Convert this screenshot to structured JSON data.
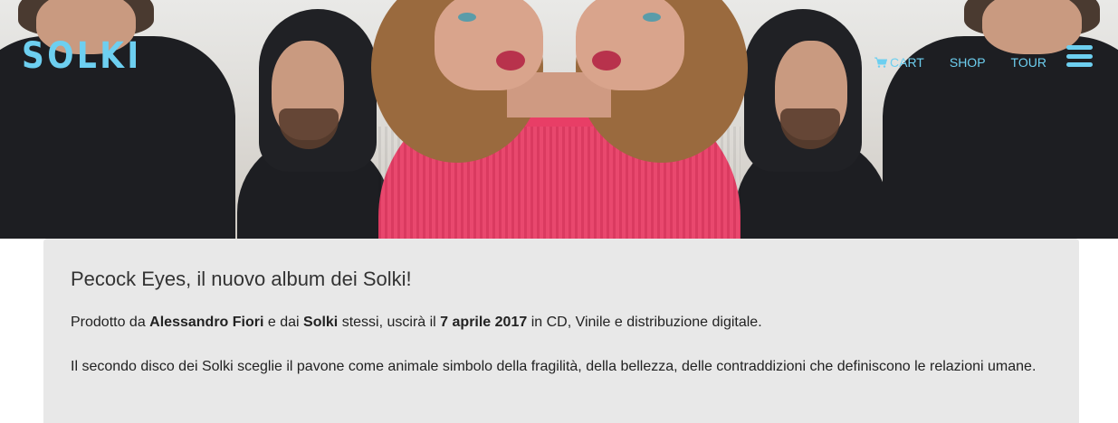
{
  "brand": {
    "logo_text": "SOLKI",
    "accent_color": "#6dcff0"
  },
  "nav": {
    "cart_icon": "shopping-cart-icon",
    "cart_label": "CART",
    "shop_label": "SHOP",
    "tour_label": "TOUR",
    "menu_icon": "hamburger-menu-icon"
  },
  "article": {
    "title": "Pecock Eyes, il nuovo album dei Solki!",
    "p1": {
      "t1": "Prodotto da ",
      "b1": "Alessandro Fiori",
      "t2": " e dai ",
      "b2": "Solki",
      "t3": " stessi, uscirà il ",
      "b3": "7 aprile 2017",
      "t4": " in CD, Vinile e distribuzione digitale."
    },
    "p2": "Il secondo disco dei Solki sceglie il pavone come animale simbolo della fragilità, della bellezza, delle contraddizioni che definiscono le relazioni umane."
  }
}
